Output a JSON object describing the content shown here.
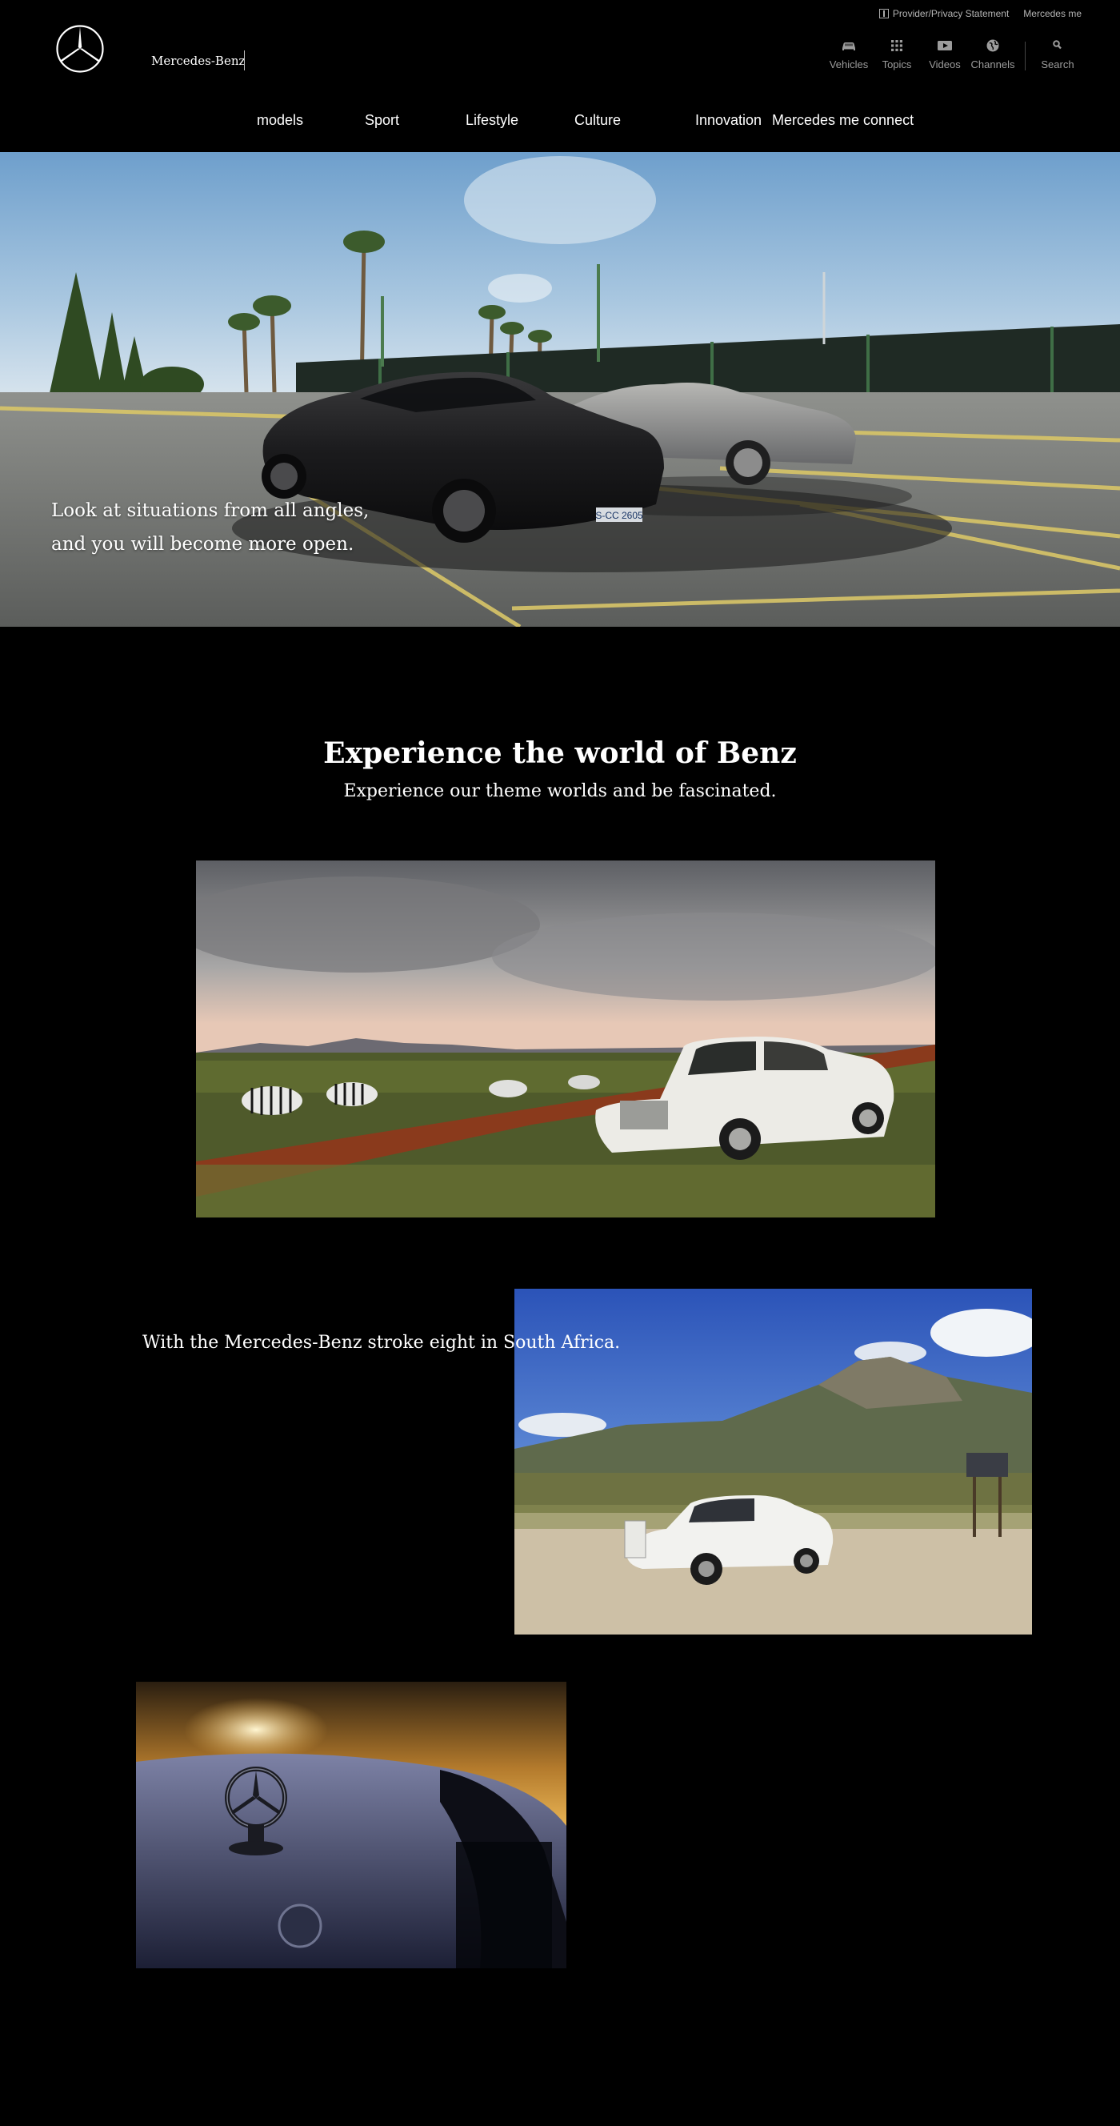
{
  "header": {
    "brand": "Mercedes-Benz",
    "top_links": [
      {
        "label": "Provider/Privacy Statement",
        "icon": "external-link-icon"
      },
      {
        "label": "Mercedes me"
      }
    ],
    "icon_nav": [
      {
        "label": "Vehicles",
        "icon": "car-icon"
      },
      {
        "label": "Topics",
        "icon": "grid-icon"
      },
      {
        "label": "Videos",
        "icon": "play-icon"
      },
      {
        "label": "Channels",
        "icon": "globe-icon"
      },
      {
        "label": "Search",
        "icon": "search-icon"
      }
    ],
    "main_nav": [
      "models",
      "Sport",
      "Lifestyle",
      "Culture",
      "Innovation",
      "Mercedes me connect"
    ]
  },
  "hero": {
    "caption_line1": "Look at situations from all angles,",
    "caption_line2": "and you will become more open.",
    "plate_front": "S-CC 2605"
  },
  "section": {
    "title": "Experience the world of Benz",
    "subtitle": "Experience our theme worlds and be fascinated."
  },
  "stories": [
    {
      "caption": "With the Mercedes-Benz stroke eight in South Africa."
    }
  ],
  "colors": {
    "background": "#000000",
    "text": "#ffffff",
    "muted": "#9c9c9c"
  }
}
